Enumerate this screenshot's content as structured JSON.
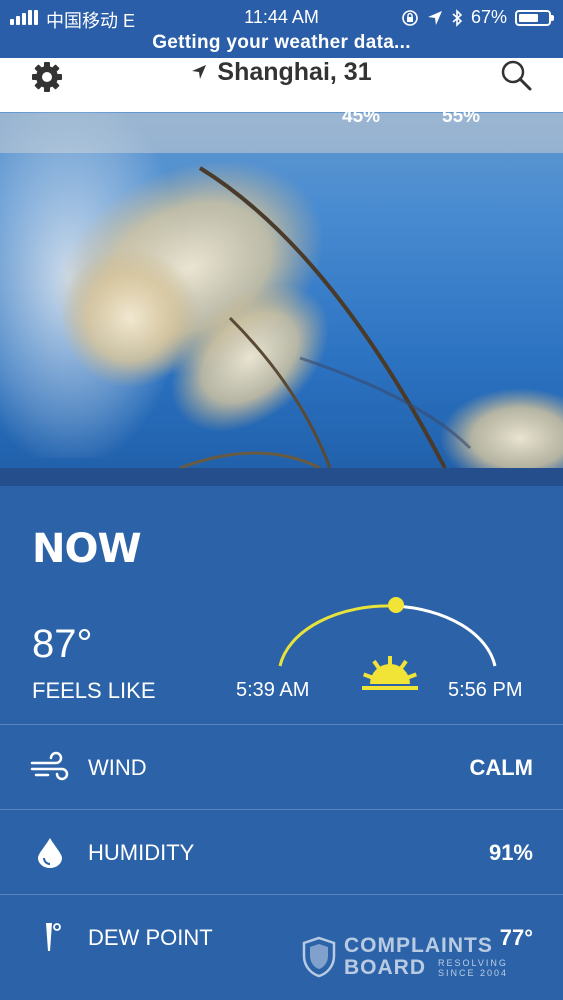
{
  "status_bar": {
    "carrier": "中国移动  E",
    "time": "11:44 AM",
    "battery": "67%",
    "battery_level": 0.67,
    "loading_message": "Getting your weather data..."
  },
  "header": {
    "location": "Shanghai, 31",
    "precip_left": "45%",
    "precip_right": "55%"
  },
  "now": {
    "title": "NOW",
    "temperature": "87°",
    "feels_like_label": "FEELS LIKE",
    "sunrise": "5:39 AM",
    "sunset": "5:56 PM",
    "sun_progress": 0.5
  },
  "details": [
    {
      "label": "WIND",
      "value": "CALM",
      "icon": "wind-icon"
    },
    {
      "label": "HUMIDITY",
      "value": "91%",
      "icon": "humidity-drop-icon"
    },
    {
      "label": "DEW POINT",
      "value": "77°",
      "icon": "thermometer-icon"
    }
  ],
  "watermark": {
    "line1": "COMPLAINTS",
    "line2": "BOARD",
    "tagline": "RESOLVING SINCE 2004"
  },
  "colors": {
    "background": "#2c63a8",
    "status_bar": "#2a5ea8",
    "sun_arc_day": "#e8e33a",
    "sun_arc_night": "#ffffff"
  }
}
